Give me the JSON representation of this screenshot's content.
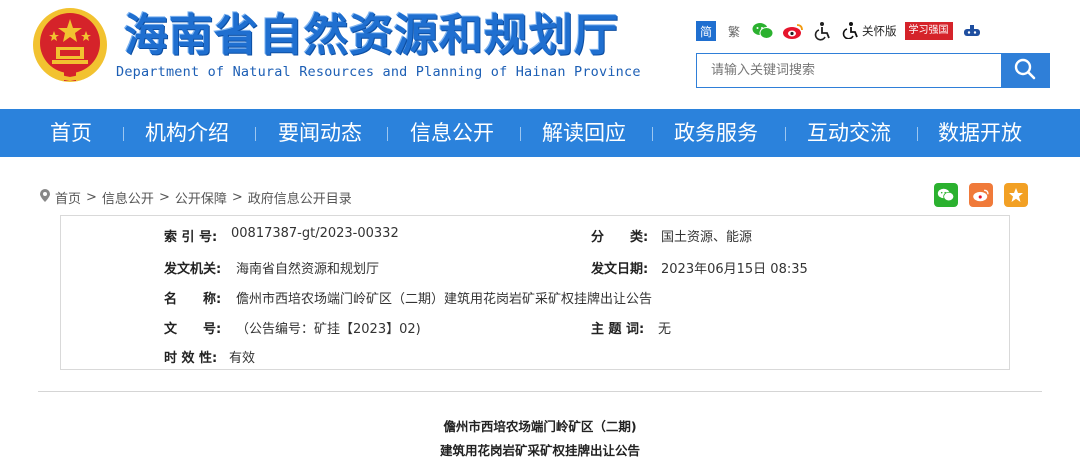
{
  "header": {
    "title": "海南省自然资源和规划厅",
    "subtitle": "Department of Natural Resources and Planning of Hainan Province",
    "emblem_icon": "national-emblem-icon"
  },
  "toolbar": {
    "simplified": "简",
    "traditional": "繁",
    "care_mode": "关怀版",
    "xuexi": "学习强国",
    "icons": [
      "wechat-icon",
      "weibo-icon",
      "accessibility-icon",
      "care-mode-icon",
      "xuexi-icon",
      "app-icon"
    ]
  },
  "search": {
    "placeholder": "请输入关键词搜索"
  },
  "nav": {
    "items": [
      "首页",
      "机构介绍",
      "要闻动态",
      "信息公开",
      "解读回应",
      "政务服务",
      "互动交流",
      "数据开放"
    ]
  },
  "breadcrumb": {
    "items": [
      "首页",
      "信息公开",
      "公开保障",
      "政府信息公开目录"
    ],
    "separator": ">"
  },
  "meta": {
    "index_label": "索 引 号:",
    "index_value": "00817387-gt/2023-00332",
    "category_label": "分　　类:",
    "category_value": "国土资源、能源",
    "issuer_label": "发文机关:",
    "issuer_value": "海南省自然资源和规划厅",
    "date_label": "发文日期:",
    "date_value": "2023年06月15日 08:35",
    "name_label": "名　　称:",
    "name_value": "儋州市西培农场端门岭矿区（二期）建筑用花岗岩矿采矿权挂牌出让公告",
    "docno_label": "文　　号:",
    "docno_value": "（公告编号：矿挂【2023】02)",
    "keywords_label": "主 题 词:",
    "keywords_value": "无",
    "validity_label": "时 效 性:",
    "validity_value": "有效"
  },
  "document": {
    "title_line1": "儋州市西培农场端门岭矿区（二期)",
    "title_line2": "建筑用花岗岩矿采矿权挂牌出让公告"
  },
  "colors": {
    "brand_blue": "#2b82dc",
    "emblem_red": "#d5232a",
    "emblem_gold": "#f2c230"
  }
}
